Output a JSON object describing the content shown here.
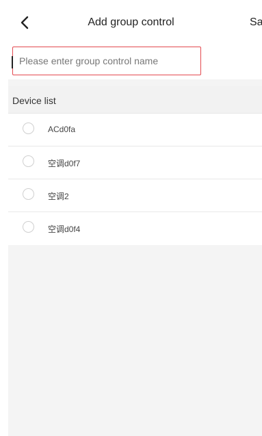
{
  "header": {
    "title": "Add group control",
    "save_label": "Sa",
    "back_icon": "chevron-left-icon"
  },
  "group_name": {
    "value": "",
    "placeholder": "Please enter group control name",
    "border_color": "#e3484e"
  },
  "device_list": {
    "title": "Device list",
    "items": [
      {
        "name": "ACd0fa",
        "selected": false
      },
      {
        "name": "空调d0f7",
        "selected": false
      },
      {
        "name": "空调2",
        "selected": false
      },
      {
        "name": "空调d0f4",
        "selected": false
      }
    ]
  }
}
